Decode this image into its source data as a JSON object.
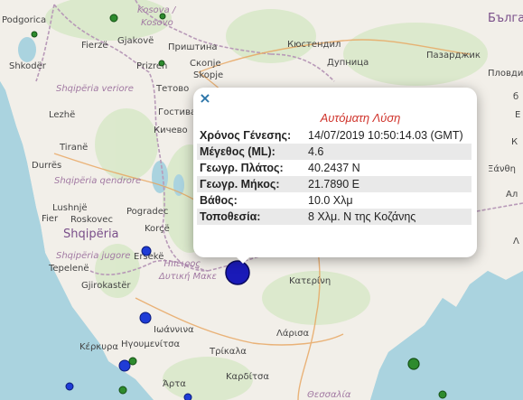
{
  "map": {
    "labels": {
      "podgorica": "Podgorica",
      "kosova": "Kosova /",
      "kosovo": "Kosovo",
      "bulg": "Бълга",
      "fierze": "Fierzë",
      "gjakove": "Gjakovë",
      "pristina": "Приштина",
      "kyustendil": "Кюстендил",
      "shkoder": "Shkodër",
      "prizren": "Prizren",
      "skopje_cyr": "Скопје",
      "skopje_lat": "Skopje",
      "dupnitsa": "Дупница",
      "pazardzhik": "Пазарджик",
      "shqiperia_veriore": "Shqipëria veriore",
      "tetovo": "Тетово",
      "plovdiv": "Пловдив",
      "lezhe": "Lezhë",
      "gostivar": "Гостивар",
      "tirane": "Tiranë",
      "kichevo": "Кичево",
      "durres": "Durrës",
      "shqiperia_qendrore": "Shqipëria qendrore",
      "lushnje": "Lushnjë",
      "pogradec": "Pogradec",
      "fier": "Fier",
      "roskovec": "Roskovec",
      "korce": "Korçë",
      "shqiperia": "Shqipëria",
      "shqiperia_jugore": "Shqipëria jugore",
      "ersek": "Ersekë",
      "tepelene": "Tepelenë",
      "epiros": "Ήπειρος",
      "dytiki": "Δυτική Μακε",
      "gjirokaster": "Gjirokastër",
      "katerini": "Κατερίνη",
      "ioannina": "Ιωάννινα",
      "larisa": "Λάρισα",
      "kerkyra": "Κέρκυρα",
      "igoumenitsa": "Ηγουμενίτσα",
      "trikala": "Τρίκαλα",
      "karditsa": "Καρδίτσα",
      "arta": "Άρτα",
      "thessalia": "Θεσσαλία",
      "xanthi": "Ξάνθη",
      "edge_e": "Е",
      "edge_k": "К",
      "edge_al": "Ал",
      "edge_l": "Λ",
      "edge_b": "б"
    },
    "colors": {
      "sea": "#aad3df",
      "land": "#f2efe9",
      "forest": "#d8e8c8",
      "border": "#b89ab8",
      "quake_blue": "#1f3cd6",
      "quake_green": "#2e8b2e",
      "selected_event": "#1a1ab8"
    }
  },
  "popup": {
    "close_icon": "×",
    "title": "Αυτόματη Λύση",
    "rows": [
      {
        "key": "Χρόνος Γένεσης:",
        "value": "14/07/2019 10:50:14.03 (GMT)"
      },
      {
        "key": "Μέγεθος (ML):",
        "value": "4.6"
      },
      {
        "key": "Γεωγρ. Πλάτος:",
        "value": "40.2437 N"
      },
      {
        "key": "Γεωγρ. Μήκος:",
        "value": "21.7890 E"
      },
      {
        "key": "Βάθος:",
        "value": "10.0 Χλμ"
      },
      {
        "key": "Τοποθεσία:",
        "value": "8 Χλμ. Ν της Κοζάνης"
      }
    ]
  }
}
